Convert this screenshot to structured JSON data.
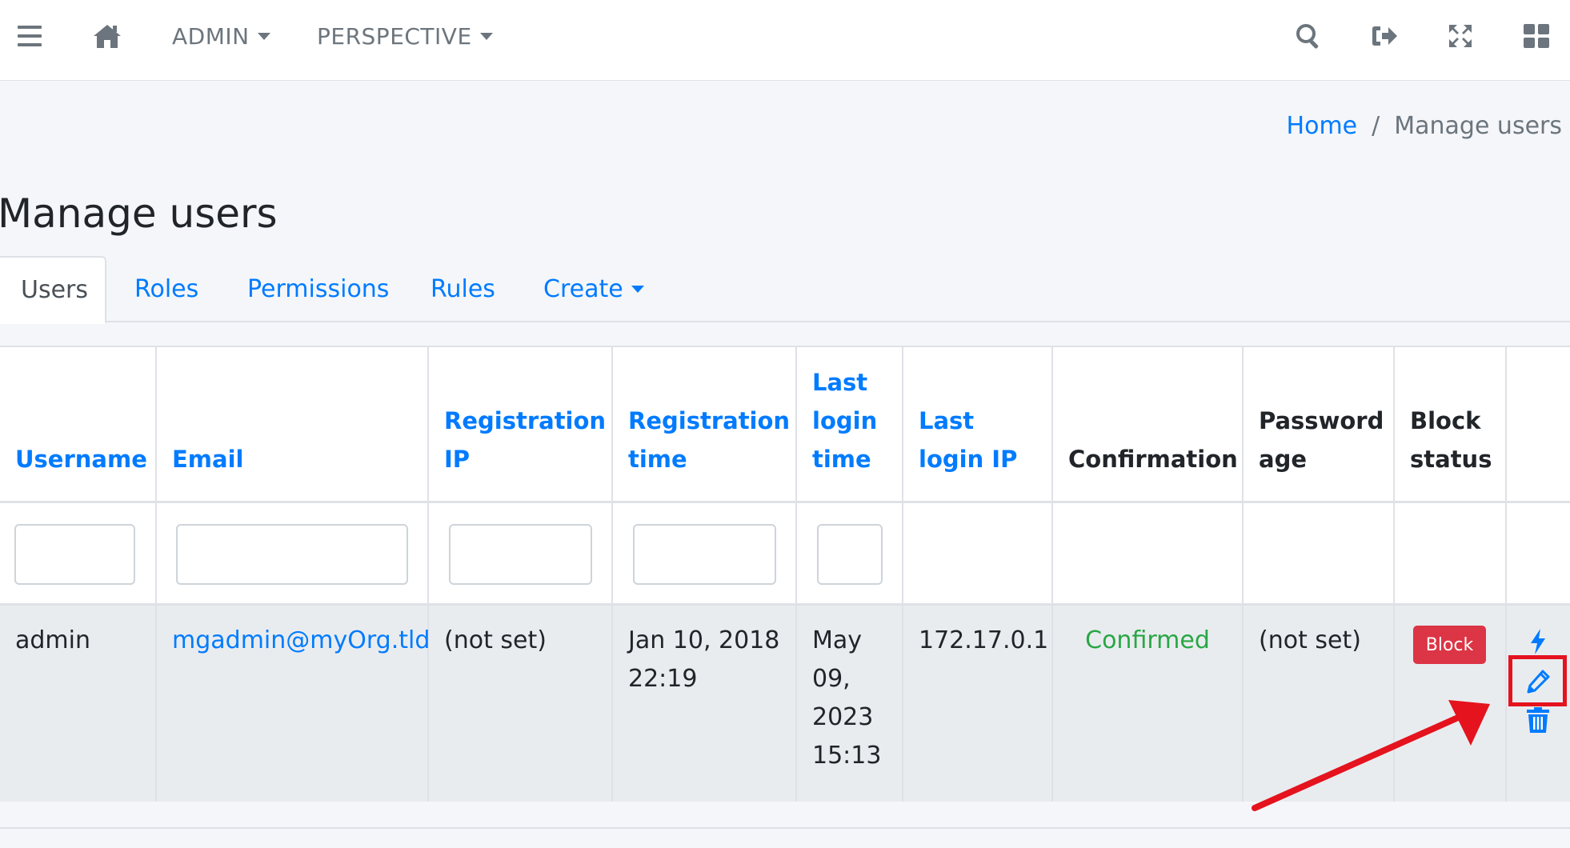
{
  "navbar": {
    "icons": [
      "menu-icon",
      "home-icon",
      "search-icon",
      "sign-out-icon",
      "expand-icon",
      "grid-icon"
    ],
    "admin_label": "ADMIN",
    "perspective_label": "PERSPECTIVE"
  },
  "breadcrumb": {
    "home": "Home",
    "separator": "/",
    "current": "Manage users"
  },
  "page": {
    "title": "Manage users"
  },
  "tabs": [
    {
      "label": "Users",
      "active": true
    },
    {
      "label": "Roles"
    },
    {
      "label": "Permissions"
    },
    {
      "label": "Rules"
    },
    {
      "label": "Create",
      "dropdown": true
    }
  ],
  "table": {
    "headers": [
      {
        "line1": "Username",
        "line2": "",
        "line3": "",
        "sortable": true
      },
      {
        "line1": "Email",
        "line2": "",
        "line3": "",
        "sortable": true
      },
      {
        "line1": "Registration",
        "line2": "IP",
        "line3": "",
        "sortable": true
      },
      {
        "line1": "Registration",
        "line2": "time",
        "line3": "",
        "sortable": true
      },
      {
        "line1": "Last",
        "line2": "login",
        "line3": "time",
        "sortable": true
      },
      {
        "line1": "Last",
        "line2": "login IP",
        "line3": "",
        "sortable": true
      },
      {
        "line1": "Confirmation",
        "line2": "",
        "line3": "",
        "sortable": false
      },
      {
        "line1": "Password",
        "line2": "age",
        "line3": "",
        "sortable": false
      },
      {
        "line1": "Block",
        "line2": "status",
        "line3": "",
        "sortable": false
      }
    ],
    "filters": [
      "",
      "",
      "",
      "",
      ""
    ],
    "row": {
      "username": "admin",
      "email": "mgadmin@myOrg.tld",
      "registration_ip": "(not set)",
      "registration_time_l1": "Jan 10, 2018",
      "registration_time_l2": "22:19",
      "last_login_l1": "May",
      "last_login_l2": "09,",
      "last_login_l3": "2023",
      "last_login_l4": "15:13",
      "last_login_ip": "172.17.0.1",
      "confirmation": "Confirmed",
      "password_age": "(not set)",
      "block_button": "Block",
      "action_icons": [
        "bolt-icon",
        "pencil-icon",
        "trash-icon"
      ]
    }
  },
  "colors": {
    "link": "#007bff",
    "danger": "#dc3545",
    "success": "#28a745",
    "annotation": "#e4131e"
  }
}
